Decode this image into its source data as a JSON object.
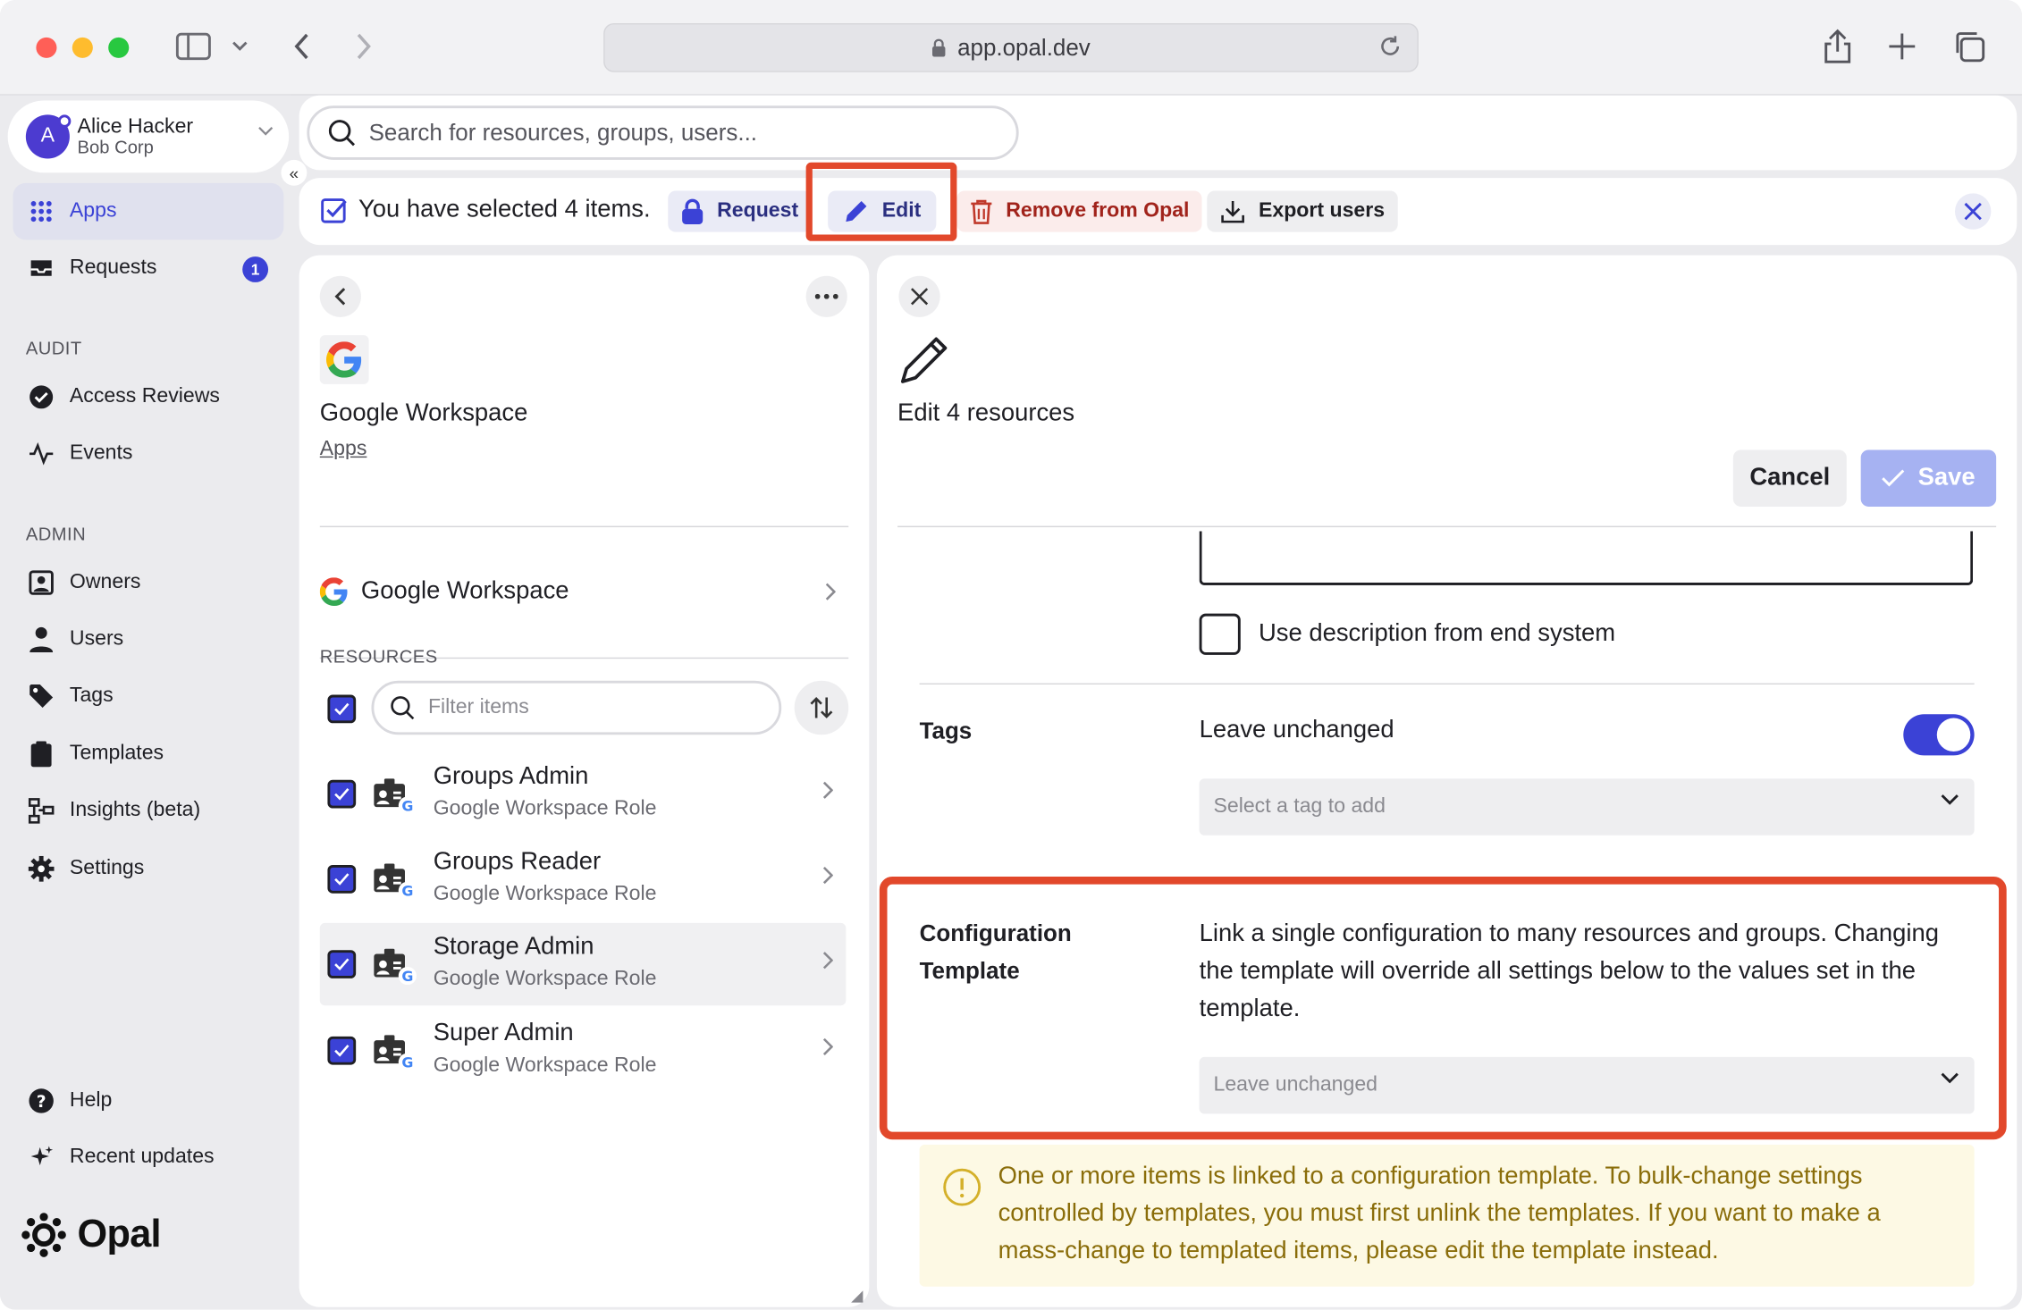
{
  "browser": {
    "url": "app.opal.dev"
  },
  "user": {
    "initial": "A",
    "name": "Alice Hacker",
    "org": "Bob Corp"
  },
  "sidebar": {
    "items": [
      {
        "label": "Apps",
        "icon": "apps-grid-icon",
        "active": true
      },
      {
        "label": "Requests",
        "icon": "inbox-icon",
        "badge": "1"
      }
    ],
    "audit_heading": "AUDIT",
    "audit_items": [
      {
        "label": "Access Reviews",
        "icon": "check-circle-icon"
      },
      {
        "label": "Events",
        "icon": "activity-icon"
      }
    ],
    "admin_heading": "ADMIN",
    "admin_items": [
      {
        "label": "Owners",
        "icon": "owner-badge-icon"
      },
      {
        "label": "Users",
        "icon": "user-icon"
      },
      {
        "label": "Tags",
        "icon": "tag-icon"
      },
      {
        "label": "Templates",
        "icon": "clipboard-icon"
      },
      {
        "label": "Insights (beta)",
        "icon": "insights-icon"
      },
      {
        "label": "Settings",
        "icon": "gear-icon"
      }
    ],
    "footer_items": [
      {
        "label": "Help",
        "icon": "help-icon"
      },
      {
        "label": "Recent updates",
        "icon": "sparkle-icon"
      }
    ],
    "logo_text": "Opal"
  },
  "search": {
    "placeholder": "Search for resources, groups, users..."
  },
  "selection_bar": {
    "text": "You have selected 4 items.",
    "request_label": "Request",
    "edit_label": "Edit",
    "remove_label": "Remove from Opal",
    "export_label": "Export users"
  },
  "middle_panel": {
    "title": "Google Workspace",
    "breadcrumb": "Apps",
    "app_row_label": "Google Workspace",
    "resources_heading": "RESOURCES",
    "filter_placeholder": "Filter items",
    "resources": [
      {
        "name": "Groups Admin",
        "type": "Google Workspace Role",
        "checked": true
      },
      {
        "name": "Groups Reader",
        "type": "Google Workspace Role",
        "checked": true
      },
      {
        "name": "Storage Admin",
        "type": "Google Workspace Role",
        "checked": true
      },
      {
        "name": "Super Admin",
        "type": "Google Workspace Role",
        "checked": true
      }
    ]
  },
  "edit_panel": {
    "title": "Edit 4 resources",
    "cancel_label": "Cancel",
    "save_label": "Save",
    "use_description_label": "Use description from end system",
    "tags_label": "Tags",
    "tags_value": "Leave unchanged",
    "tags_toggle_on": true,
    "tag_select_placeholder": "Select a tag to add",
    "config_label_line1": "Configuration",
    "config_label_line2": "Template",
    "config_description": "Link a single configuration to many resources and groups. Changing the template will override all settings below to the values set in the template.",
    "config_select_value": "Leave unchanged",
    "warning_text": "One or more items is linked to a configuration template. To bulk-change settings controlled by templates, you must first unlink the templates. If you want to make a mass-change to templated items, please edit the template instead."
  },
  "colors": {
    "accent": "#3b42d6",
    "highlight": "#e2482b",
    "warning_bg": "#fdf9e4",
    "warning_text": "#8a6d0a"
  }
}
